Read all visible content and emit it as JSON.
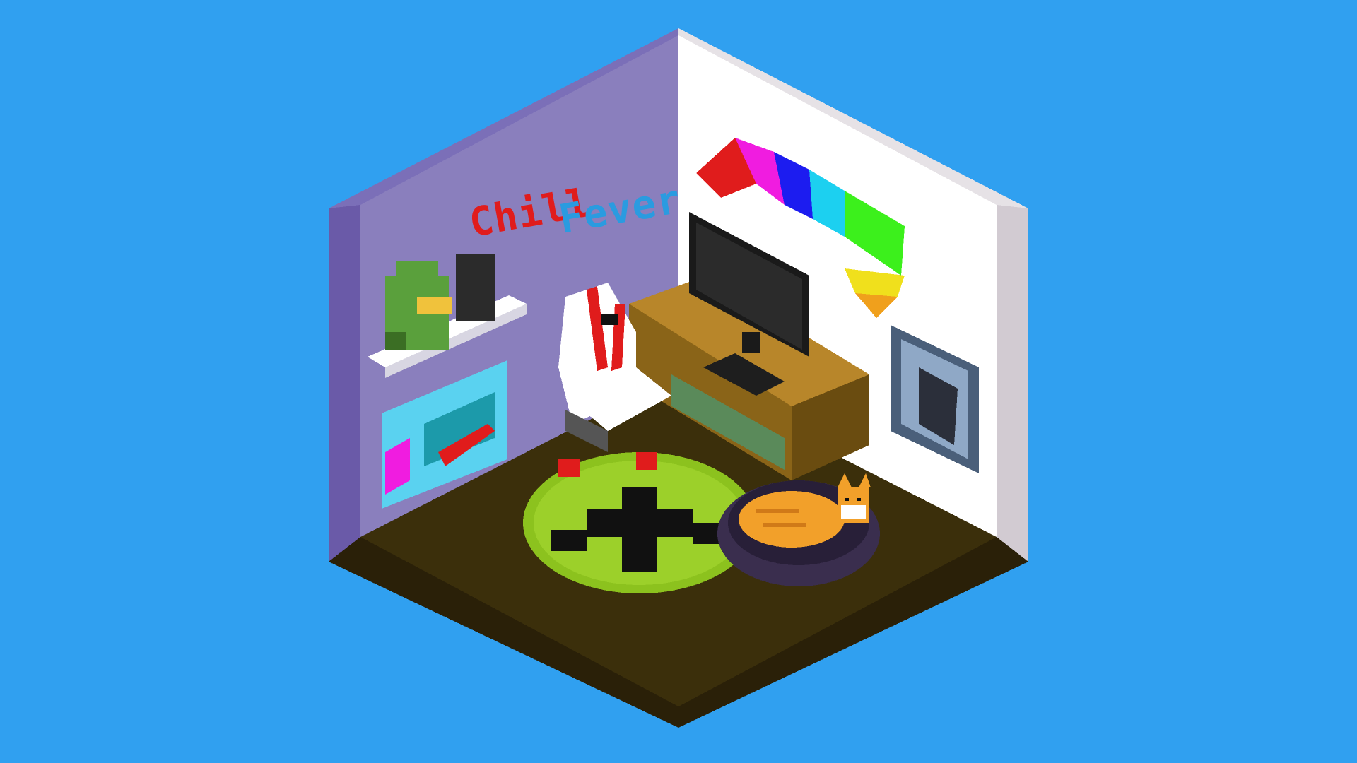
{
  "scene": {
    "background_color": "#30a0f0",
    "wall_text": {
      "word1": "Chill",
      "word2": "Fever",
      "word1_color": "#e01c1c",
      "word2_color": "#2a9be0"
    },
    "palette": {
      "left_wall": "#8a7fbd",
      "left_wall_edge": "#6a5aa8",
      "right_wall": "#ffffff",
      "right_wall_top": "#e6e2e6",
      "floor": "#3b2f0b",
      "floor_edge": "#2a2008",
      "rug": "#8cc21e",
      "cat_fur": "#f2a02a",
      "cat_bed": "#3a2e4e",
      "tv_stand": "#b8862a",
      "tv_screen": "#2b2b2b"
    },
    "objects": [
      {
        "name": "gaming-chair",
        "colors": [
          "#ffffff",
          "#e01c1c",
          "#555555"
        ]
      },
      {
        "name": "tv",
        "colors": [
          "#2b2b2b"
        ]
      },
      {
        "name": "tv-stand",
        "colors": [
          "#b8862a"
        ]
      },
      {
        "name": "wall-shelf",
        "colors": [
          "#ffffff"
        ]
      },
      {
        "name": "cat",
        "colors": [
          "#f2a02a"
        ]
      },
      {
        "name": "rainbow-flag",
        "colors": [
          "#e01c1c",
          "#f01ce0",
          "#1c1cf0",
          "#1cd0f0",
          "#3cf01c",
          "#f0e01c",
          "#f0a01c"
        ]
      },
      {
        "name": "helmet-figure",
        "colors": [
          "#5aa03c",
          "#f0c23c"
        ]
      }
    ]
  }
}
